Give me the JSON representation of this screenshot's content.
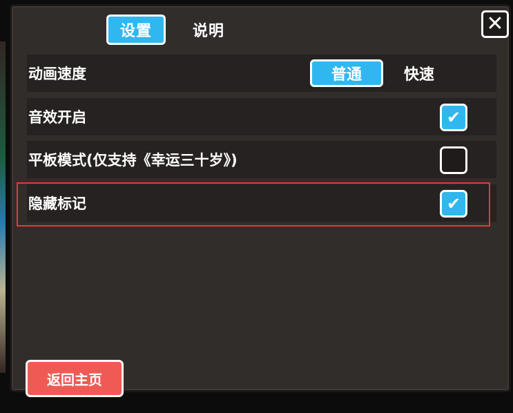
{
  "tabs": {
    "settings": "设置",
    "help": "说明"
  },
  "close": {
    "symbol": "✕"
  },
  "settings": {
    "animation_speed": {
      "label": "动画速度",
      "options": [
        "普通",
        "快速"
      ],
      "selected": "普通"
    },
    "sound": {
      "label": "音效开启",
      "checked": true
    },
    "tablet_mode": {
      "label": "平板模式(仅支持《幸运三十岁》)",
      "checked": false
    },
    "hide_marks": {
      "label": "隐藏标记",
      "checked": true
    }
  },
  "checkmark_glyph": "✔",
  "home_button": "返回主页",
  "colors": {
    "accent": "#30b7f0",
    "panel": "#312d2b",
    "row": "#262221",
    "home_button": "#f05a55",
    "highlight": "#e53935"
  }
}
